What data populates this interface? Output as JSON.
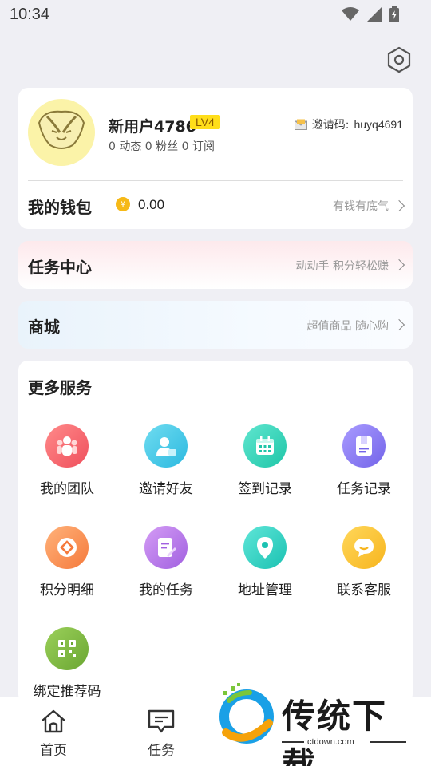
{
  "status_bar": {
    "time": "10:34"
  },
  "profile": {
    "username": "新用户4786",
    "level": "LV4",
    "stats": "0 动态 0 粉丝 0 订阅",
    "invite_label": "邀请码:",
    "invite_code": "huyq4691"
  },
  "wallet": {
    "title": "我的钱包",
    "amount": "0.00",
    "hint": "有钱有底气"
  },
  "task_center": {
    "title": "任务中心",
    "hint": "动动手 积分轻松赚"
  },
  "mall": {
    "title": "商城",
    "hint": "超值商品 随心购"
  },
  "services": {
    "title": "更多服务",
    "items": [
      {
        "label": "我的团队",
        "icon": "team-icon"
      },
      {
        "label": "邀请好友",
        "icon": "invite-friend-icon"
      },
      {
        "label": "签到记录",
        "icon": "checkin-calendar-icon"
      },
      {
        "label": "任务记录",
        "icon": "task-record-icon"
      },
      {
        "label": "积分明细",
        "icon": "points-detail-icon"
      },
      {
        "label": "我的任务",
        "icon": "my-task-icon"
      },
      {
        "label": "地址管理",
        "icon": "location-pin-icon"
      },
      {
        "label": "联系客服",
        "icon": "chat-bubble-icon"
      },
      {
        "label": "绑定推荐码",
        "icon": "qr-code-icon"
      }
    ]
  },
  "bottom_nav": [
    {
      "label": "首页",
      "icon": "home-icon"
    },
    {
      "label": "任务",
      "icon": "message-icon"
    }
  ],
  "watermark": {
    "title": "传统下载",
    "sub": "ctdown.com"
  }
}
